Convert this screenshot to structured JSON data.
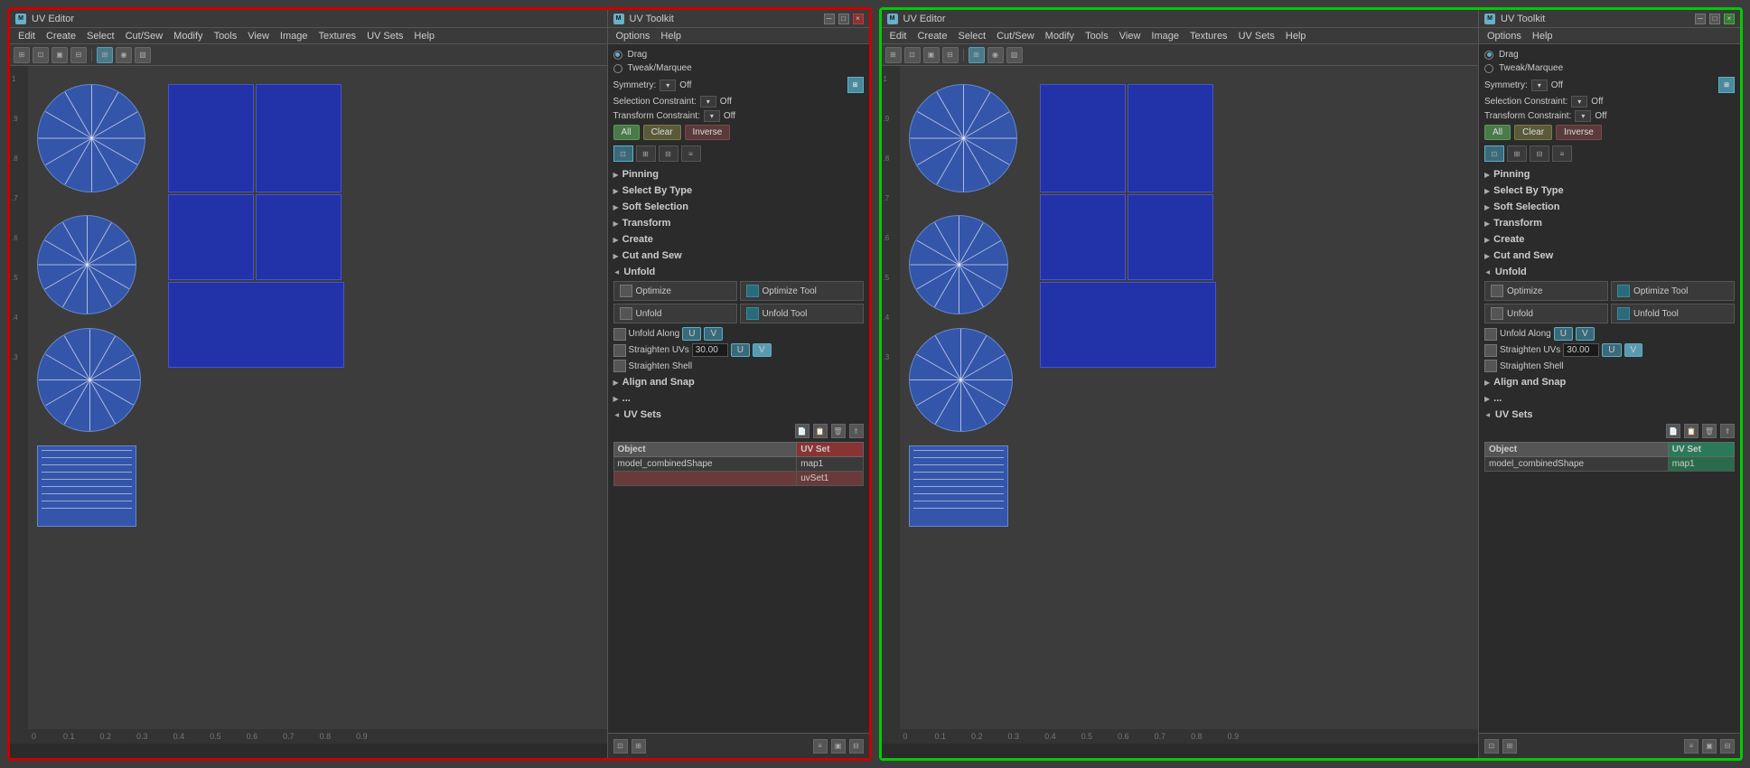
{
  "panels": [
    {
      "id": "left",
      "border": "red",
      "uv_editor": {
        "title": "UV Editor",
        "menus": [
          "Edit",
          "Create",
          "Select",
          "Cut/Sew",
          "Modify",
          "Tools",
          "View",
          "Image",
          "Textures",
          "UV Sets",
          "Help"
        ],
        "ruler_h_nums": [
          "0.1",
          "0.2",
          "0.3",
          "0.4",
          "0.5",
          "0.6",
          "0.7",
          "0.8",
          "0.9"
        ],
        "ruler_v_nums": [
          "0.9",
          "0.8",
          "0.7",
          "0.6",
          "0.5",
          "0.4",
          "0.3"
        ]
      },
      "uv_toolkit": {
        "title": "UV Toolkit",
        "menus": [
          "Options",
          "Help"
        ],
        "mode_drag": "Drag",
        "mode_tweak": "Tweak/Marquee",
        "symmetry_label": "Symmetry:",
        "symmetry_val": "Off",
        "selection_constraint_label": "Selection Constraint:",
        "selection_constraint_val": "Off",
        "transform_constraint_label": "Transform Constraint:",
        "transform_constraint_val": "Off",
        "btn_all": "All",
        "btn_clear": "Clear",
        "btn_inverse": "Inverse",
        "sections": {
          "pinning": "Pinning",
          "select_by_type": "Select By Type",
          "soft_selection": "Soft Selection",
          "transform": "Transform",
          "create": "Create",
          "cut_and_sew": "Cut and Sew",
          "unfold": "Unfold",
          "align_and_snap": "Align and Snap",
          "uv_sets": "UV Sets"
        },
        "unfold": {
          "optimize": "Optimize",
          "optimize_tool": "Optimize Tool",
          "unfold": "Unfold",
          "unfold_tool": "Unfold Tool",
          "unfold_along": "Unfold Along",
          "unfold_along_u": "U",
          "unfold_along_v": "V",
          "straighten_uvs": "Straighten UVs",
          "straighten_val": "30.00",
          "straighten_u": "U",
          "straighten_v": "V",
          "straighten_shell": "Straighten Shell"
        },
        "uvsets": {
          "col_object": "Object",
          "col_uvset": "UV Set",
          "row1_object": "model_combinedShape",
          "row1_uvset": "map1",
          "row2_object": "",
          "row2_uvset": "uvSet1"
        }
      }
    },
    {
      "id": "right",
      "border": "green",
      "uv_editor": {
        "title": "UV Editor",
        "menus": [
          "Edit",
          "Create",
          "Select",
          "Cut/Sew",
          "Modify",
          "Tools",
          "View",
          "Image",
          "Textures",
          "UV Sets",
          "Help"
        ],
        "ruler_h_nums": [
          "0.1",
          "0.2",
          "0.3",
          "0.4",
          "0.5",
          "0.6",
          "0.7",
          "0.8",
          "0.9"
        ],
        "ruler_v_nums": [
          "0.9",
          "0.8",
          "0.7",
          "0.6",
          "0.5",
          "0.4",
          "0.3"
        ]
      },
      "uv_toolkit": {
        "title": "UV Toolkit",
        "menus": [
          "Options",
          "Help"
        ],
        "mode_drag": "Drag",
        "mode_tweak": "Tweak/Marquee",
        "symmetry_label": "Symmetry:",
        "symmetry_val": "Off",
        "selection_constraint_label": "Selection Constraint:",
        "selection_constraint_val": "Off",
        "transform_constraint_label": "Transform Constraint:",
        "transform_constraint_val": "Off",
        "btn_all": "All",
        "btn_clear": "Clear",
        "btn_inverse": "Inverse",
        "sections": {
          "pinning": "Pinning",
          "select_by_type": "Select By Type",
          "soft_selection": "Soft Selection",
          "transform": "Transform",
          "create": "Create",
          "cut_and_sew": "Cut and Sew",
          "unfold": "Unfold",
          "align_and_snap": "Align and Snap",
          "uv_sets": "UV Sets"
        },
        "unfold": {
          "optimize": "Optimize",
          "optimize_tool": "Optimize Tool",
          "unfold": "Unfold",
          "unfold_tool": "Unfold Tool",
          "unfold_along": "Unfold Along",
          "unfold_along_u": "U",
          "unfold_along_v": "V",
          "straighten_uvs": "Straighten UVs",
          "straighten_val": "30.00",
          "straighten_u": "U",
          "straighten_v": "V",
          "straighten_shell": "Straighten Shell"
        },
        "uvsets": {
          "col_object": "Object",
          "col_uvset": "UV Set",
          "row1_object": "model_combinedShape",
          "row1_uvset": "map1",
          "row2_object": "",
          "row2_uvset": ""
        }
      }
    }
  ]
}
